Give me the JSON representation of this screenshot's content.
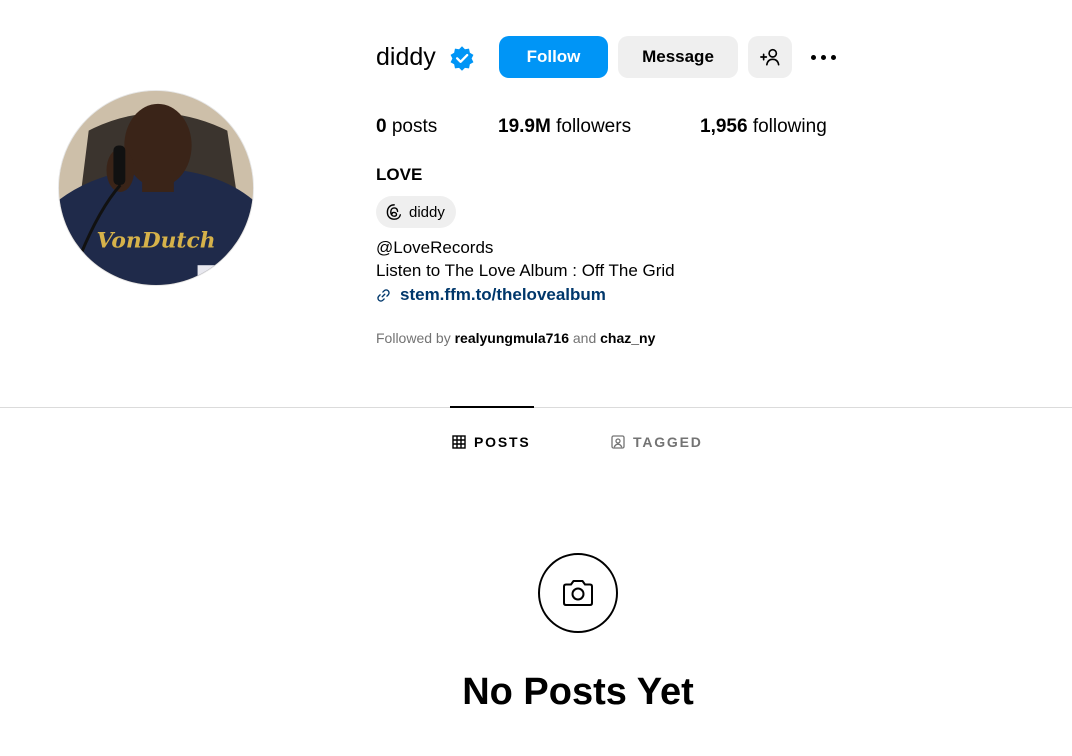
{
  "profile": {
    "username": "diddy",
    "verified": true,
    "follow_label": "Follow",
    "message_label": "Message",
    "icons": {
      "verified": "verified-badge-icon",
      "add_user": "add-user-icon",
      "more": "more-options-icon"
    }
  },
  "stats": {
    "posts_count": "0",
    "posts_label": "posts",
    "followers_count": "19.9M",
    "followers_label": "followers",
    "following_count": "1,956",
    "following_label": "following"
  },
  "bio": {
    "full_name": "LOVE",
    "threads_handle": "diddy",
    "handle": "@LoveRecords",
    "text": "Listen to The Love Album : Off The Grid",
    "link": "stem.ffm.to/thelovealbum",
    "followed_by_prefix": "Followed by",
    "followed_by_users": [
      "realyungmula716",
      "chaz_ny"
    ],
    "followed_by_joiner": "and"
  },
  "tabs": [
    {
      "label": "POSTS",
      "icon": "grid-icon",
      "active": true
    },
    {
      "label": "TAGGED",
      "icon": "tagged-icon",
      "active": false
    }
  ],
  "empty_state": {
    "icon": "camera-icon",
    "title": "No Posts Yet"
  },
  "colors": {
    "follow_button": "#0095f6",
    "secondary_button": "#efefef",
    "link": "#00376b",
    "verified": "#0095f6",
    "muted_text": "#737373",
    "divider": "#dbdbdb"
  }
}
